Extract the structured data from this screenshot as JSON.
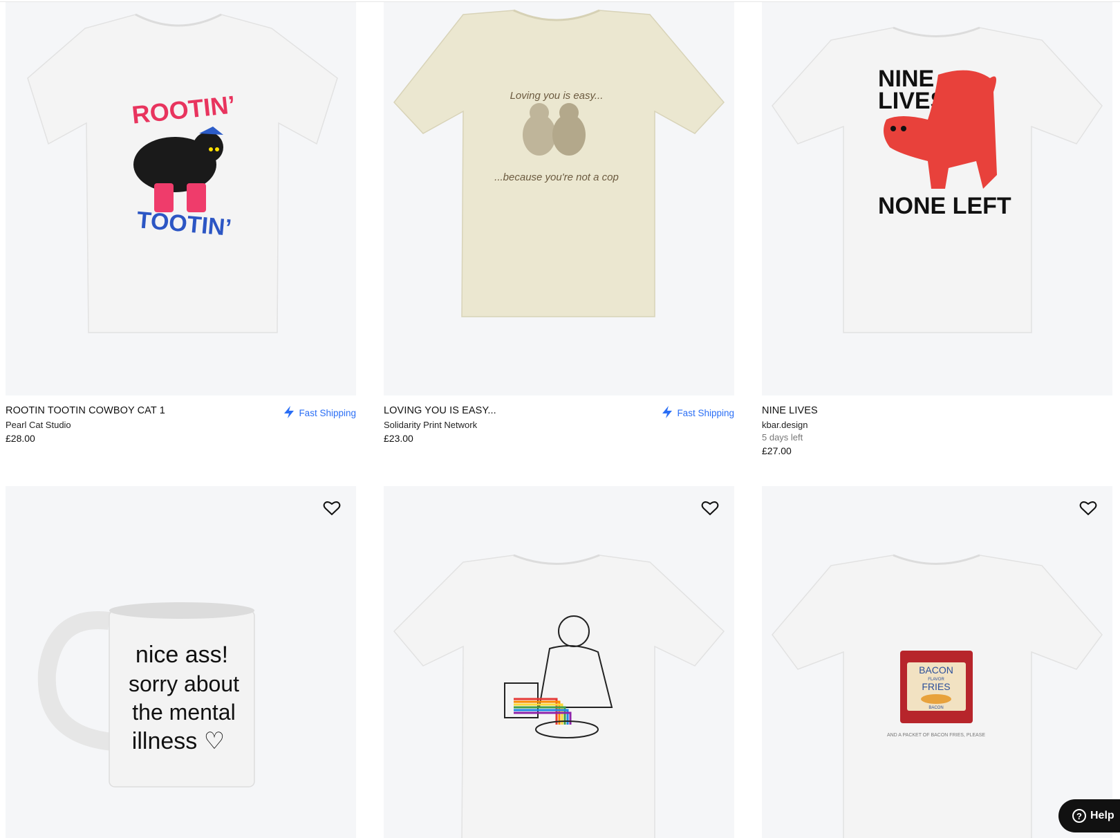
{
  "products": [
    {
      "title": "ROOTIN TOOTIN COWBOY CAT 1",
      "maker": "Pearl Cat Studio",
      "price": "£28.00",
      "shipping": "Fast Shipping",
      "print_top": "ROOTIN’",
      "print_bottom": "TOOTIN’"
    },
    {
      "title": "LOVING YOU IS EASY...",
      "maker": "Solidarity Print Network",
      "price": "£23.00",
      "shipping": "Fast Shipping",
      "print_top": "Loving you is easy...",
      "print_bottom": "...because you're not a cop"
    },
    {
      "title": "NINE LIVES",
      "maker": "kbar.design",
      "days_left": "5 days left",
      "price": "£27.00",
      "print_line1": "NINE",
      "print_line2": "LIVES",
      "print_line3": "NONE LEFT"
    },
    {
      "print_lines": [
        "nice ass!",
        "sorry about",
        "the mental",
        "illness ♡"
      ]
    },
    {},
    {
      "pack_line1": "BACON",
      "pack_line2": "FLAVOR",
      "pack_line3": "FRIES",
      "pack_line4": "BACON",
      "caption": "AND A PACKET OF BACON FRIES, PLEASE"
    }
  ],
  "help_button": {
    "label": "Help"
  },
  "icons": {
    "wishlist": "heart-icon",
    "shipping": "lightning-icon",
    "help": "question-icon"
  },
  "colors": {
    "accent": "#2a6ef5",
    "tile_bg": "#f5f6f8"
  }
}
